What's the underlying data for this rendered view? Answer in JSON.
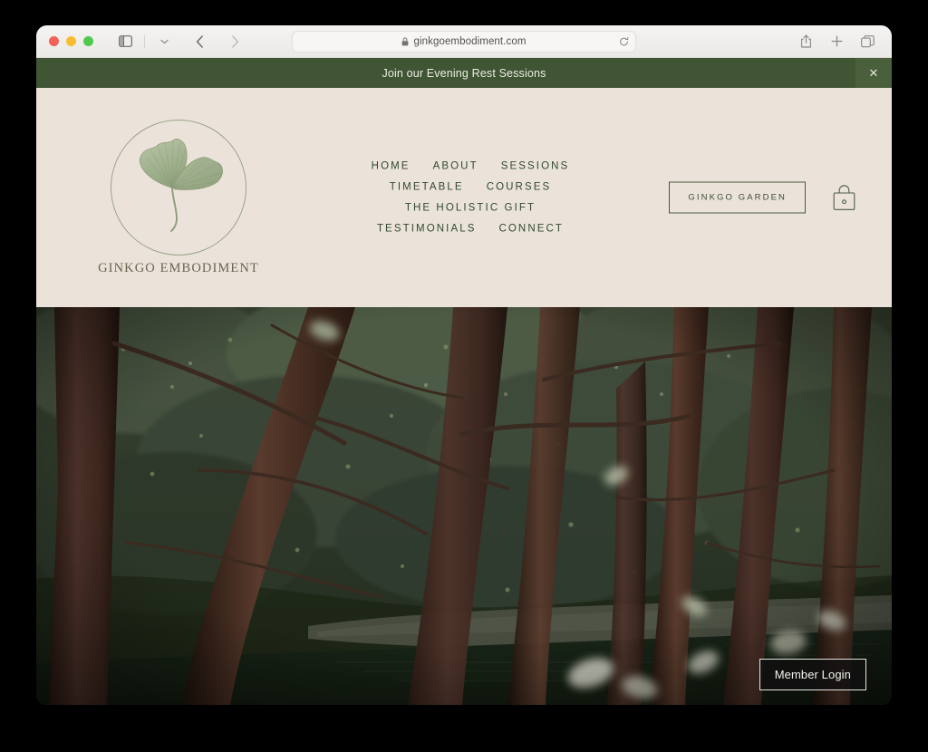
{
  "browser": {
    "url": "ginkgoembodiment.com",
    "icons": {
      "sidebar": "sidebar-toggle-icon",
      "chevron": "chevron-down-icon",
      "back": "back-arrow-icon",
      "forward": "forward-arrow-icon",
      "lock": "lock-icon",
      "reload": "reload-icon",
      "share": "share-icon",
      "newtab": "plus-icon",
      "tabs": "tab-overview-icon"
    }
  },
  "banner": {
    "text": "Join our Evening Rest Sessions",
    "close_label": "✕",
    "bg_color": "#3f5534",
    "close_bg_color": "#4a603d"
  },
  "header": {
    "bg_color": "#ebe3da",
    "brand_name": "GINKGO EMBODIMENT",
    "logo_alt": "ginkgo-leaf-logo",
    "nav_rows": [
      [
        "HOME",
        "ABOUT",
        "SESSIONS"
      ],
      [
        "TIMETABLE",
        "COURSES"
      ],
      [
        "THE HOLISTIC GIFT"
      ],
      [
        "TESTIMONIALS",
        "CONNECT"
      ]
    ],
    "cta_label": "GINKGO GARDEN",
    "cart_label": "shopping-bag-icon",
    "accent_color": "#31482b"
  },
  "hero": {
    "alt": "forest-trees-over-pond",
    "member_login_label": "Member Login"
  }
}
